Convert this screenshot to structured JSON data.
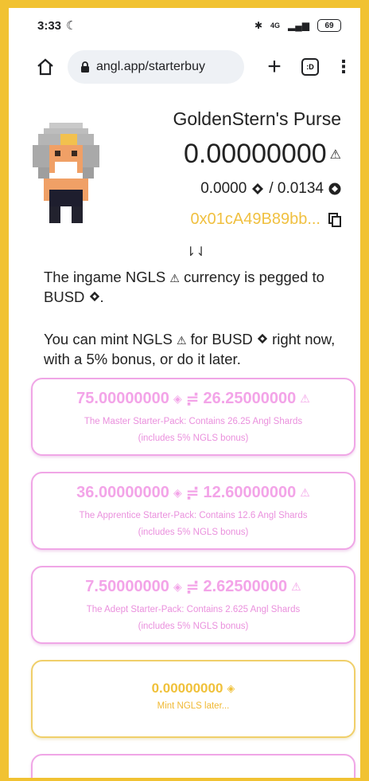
{
  "status": {
    "time": "3:33",
    "network": "4G",
    "battery": "69"
  },
  "browser": {
    "url": "angl.app/starterbuy",
    "tabs_label": ":D"
  },
  "wallet": {
    "name": "GoldenStern's Purse",
    "balance": "0.00000000",
    "busd_balance": "0.0000",
    "bnb_balance": "/ 0.0134",
    "address": "0x01cA49B89bb..."
  },
  "arrows": "⇂⇃",
  "intro": {
    "line1a": "The ingame NGLS",
    "line1b": "currency is pegged to BUSD",
    "line1c": ".",
    "line2a": "You can mint NGLS",
    "line2b": "for BUSD",
    "line2c": "right now, with a 5% bonus, or do it later."
  },
  "packs": [
    {
      "busd": "75.00000000",
      "ngls": "26.25000000",
      "desc": "The Master Starter-Pack: Contains 26.25 Angl Shards",
      "bonus": "(includes 5% NGLS bonus)"
    },
    {
      "busd": "36.00000000",
      "ngls": "12.60000000",
      "desc": "The Apprentice Starter-Pack: Contains 12.6 Angl Shards",
      "bonus": "(includes 5% NGLS bonus)"
    },
    {
      "busd": "7.50000000",
      "ngls": "2.62500000",
      "desc": "The Adept Starter-Pack: Contains 2.625 Angl Shards",
      "bonus": "(includes 5% NGLS bonus)"
    }
  ],
  "later": {
    "amount": "0.00000000",
    "label": "Mint NGLS later..."
  },
  "icons": {
    "ngls": "ngls-triangle-icon",
    "busd": "busd-diamond-icon",
    "bnb": "bnb-coin-icon",
    "copy": "copy-icon"
  },
  "colors": {
    "frame": "#f1c232",
    "pack_border": "#f0a6e6",
    "pack_text": "#f3a4e8",
    "later_border": "#f0cf6a",
    "address": "#f0c040"
  }
}
